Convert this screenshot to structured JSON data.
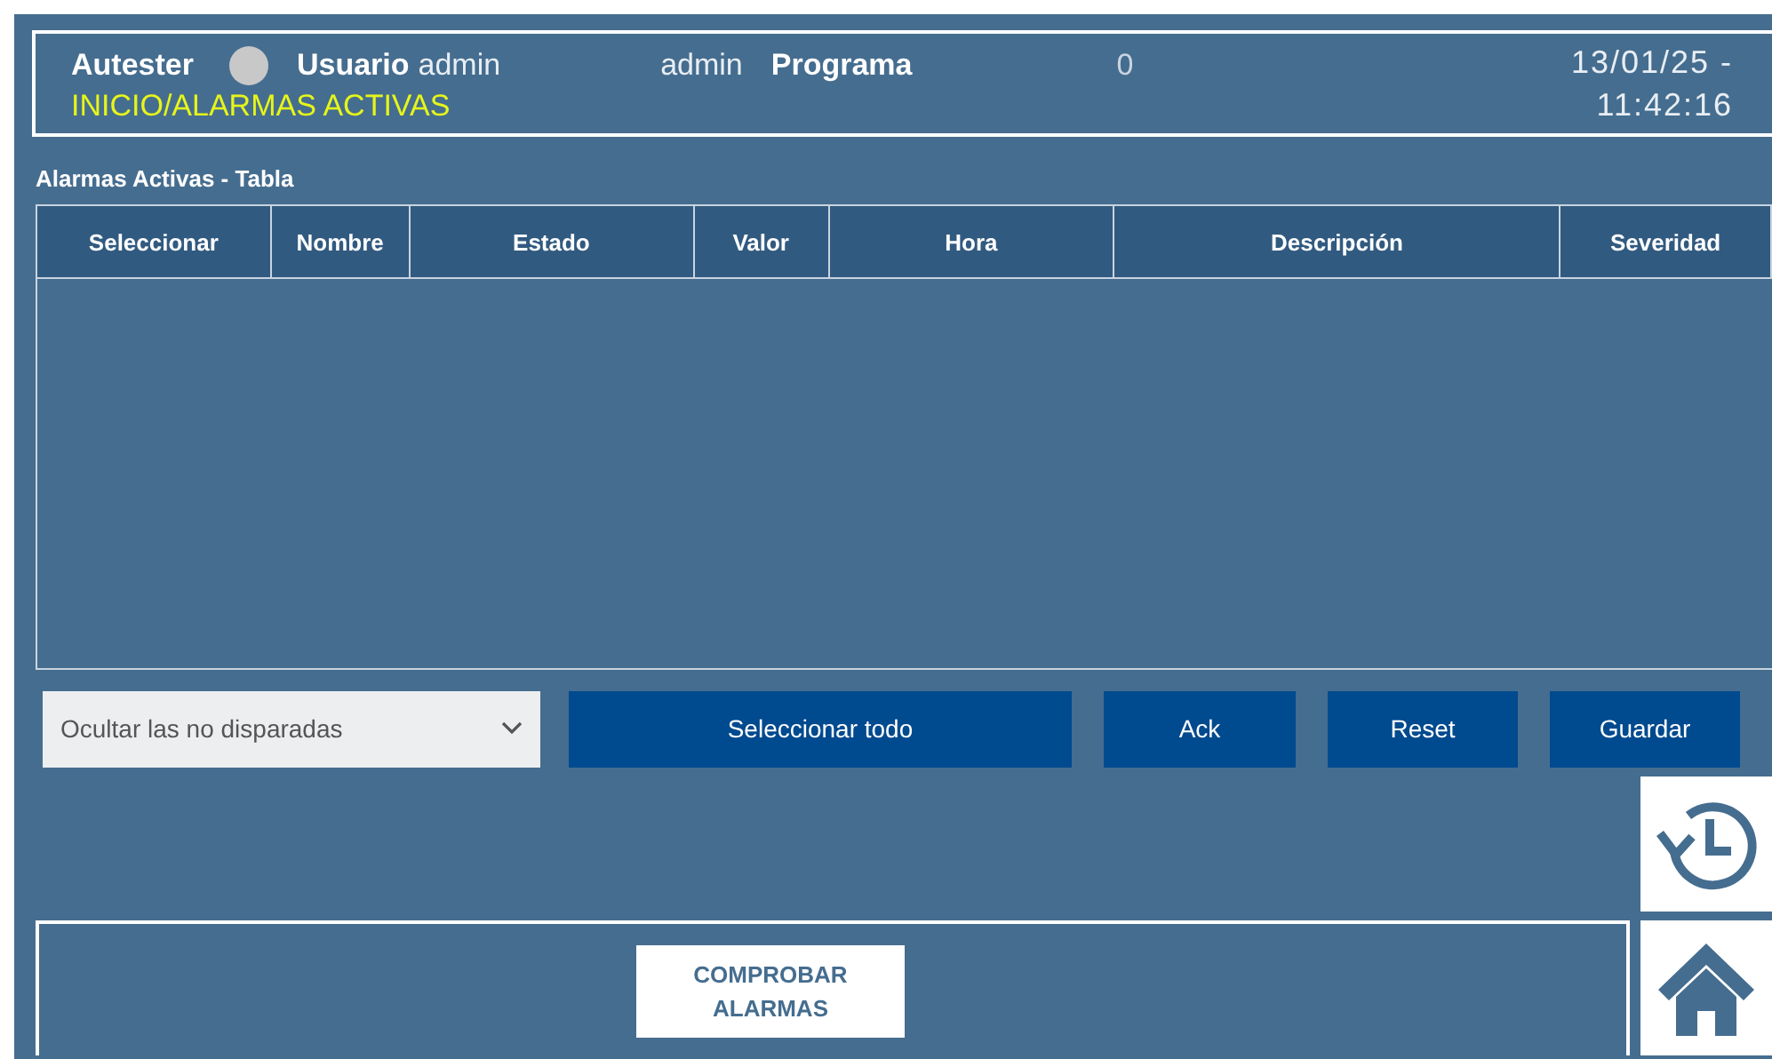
{
  "header": {
    "app_name": "Autester",
    "user_label": "Usuario",
    "user": "admin",
    "user_2": "admin",
    "program_label": "Programa",
    "program_value": "0",
    "date": "13/01/25 -",
    "time": "11:42:16",
    "breadcrumb": "INICIO/ALARMAS ACTIVAS"
  },
  "table": {
    "title": "Alarmas Activas - Tabla",
    "columns": [
      "Seleccionar",
      "Nombre",
      "Estado",
      "Valor",
      "Hora",
      "Descripción",
      "Severidad"
    ]
  },
  "filter": {
    "value": "Ocultar las no disparadas"
  },
  "buttons": [
    "Seleccionar todo",
    "Ack",
    "Reset",
    "Guardar"
  ],
  "check_button": "COMPROBAR ALARMAS"
}
